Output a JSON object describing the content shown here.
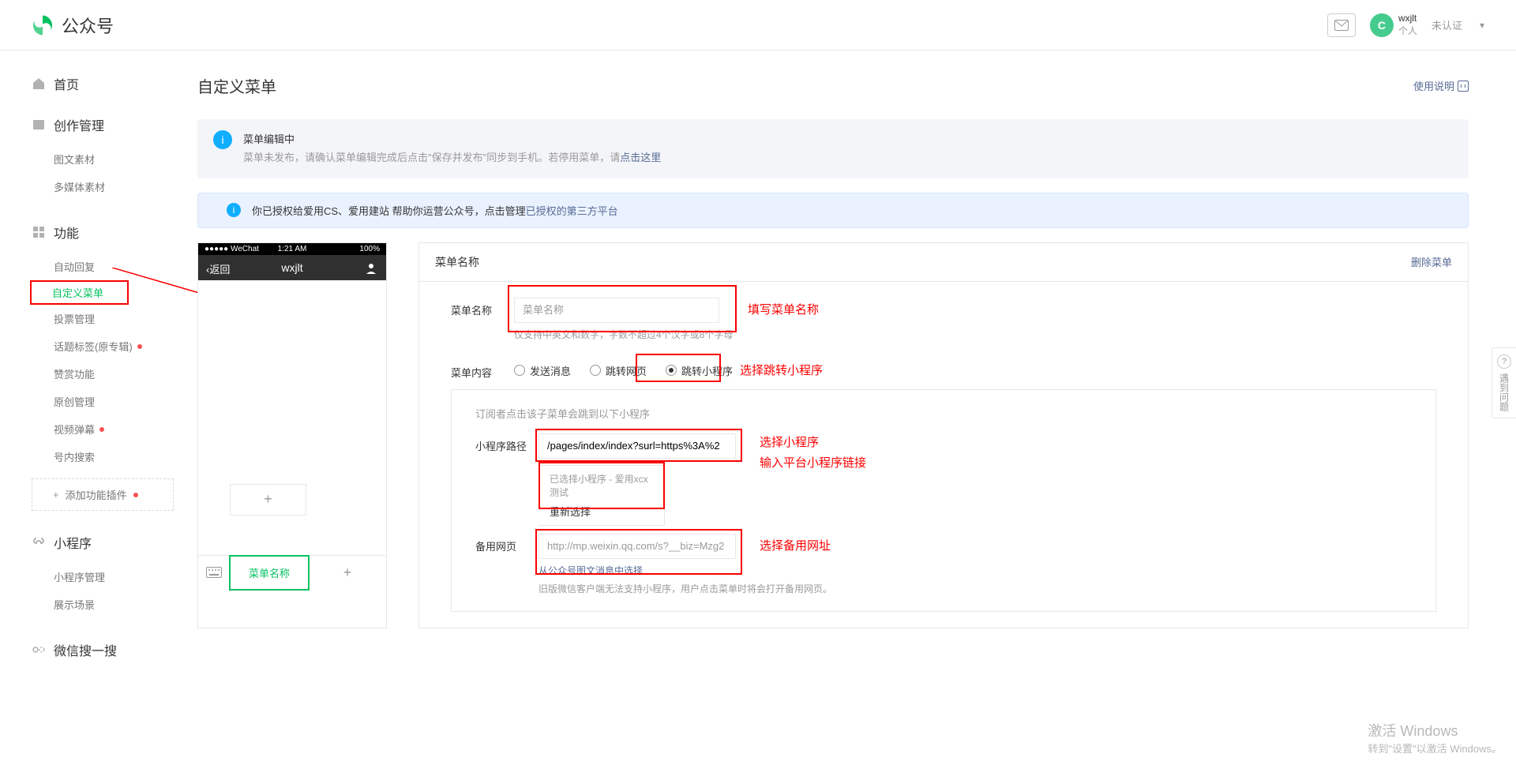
{
  "header": {
    "brand": "公众号",
    "user": {
      "name": "wxjlt",
      "role": "个人",
      "verify": "未认证"
    }
  },
  "sidebar": {
    "home": "首页",
    "sections": [
      {
        "title": "创作管理",
        "items": [
          {
            "label": "图文素材"
          },
          {
            "label": "多媒体素材"
          }
        ]
      },
      {
        "title": "功能",
        "items": [
          {
            "label": "自动回复"
          },
          {
            "label": "自定义菜单",
            "active": true
          },
          {
            "label": "投票管理"
          },
          {
            "label": "话题标签(原专辑)",
            "dot": true
          },
          {
            "label": "赞赏功能"
          },
          {
            "label": "原创管理"
          },
          {
            "label": "视频弹幕",
            "dot": true
          },
          {
            "label": "号内搜索"
          }
        ],
        "addPlugin": "添加功能插件",
        "addPluginDot": true
      },
      {
        "title": "小程序",
        "items": [
          {
            "label": "小程序管理"
          },
          {
            "label": "展示场景"
          }
        ]
      },
      {
        "title": "微信搜一搜",
        "items": []
      }
    ]
  },
  "page": {
    "title": "自定义菜单",
    "instructions": "使用说明"
  },
  "alert1": {
    "title": "菜单编辑中",
    "body_prefix": "菜单未发布，请确认菜单编辑完成后点击\"保存并发布\"同步到手机。若停用菜单，请",
    "body_link": "点击这里"
  },
  "alert2": {
    "body_prefix": "你已授权给爱用CS、爱用建站 帮助你运营公众号，点击管理",
    "body_link": "已授权的第三方平台"
  },
  "phone": {
    "carrier": "●●●●● WeChat",
    "time": "1:21 AM",
    "battery": "100%",
    "back": "返回",
    "title": "wxjlt",
    "menu_active": "菜单名称",
    "add": "+"
  },
  "form": {
    "head": "菜单名称",
    "delete": "删除菜单",
    "name_label": "菜单名称",
    "name_placeholder": "菜单名称",
    "name_help": "仅支持中英文和数字，字数不超过4个汉字或8个字母",
    "content_label": "菜单内容",
    "radios": [
      "发送消息",
      "跳转网页",
      "跳转小程序"
    ],
    "subpanel_desc": "订阅者点击该子菜单会跳到以下小程序",
    "path_label": "小程序路径",
    "path_value": "/pages/index/index?surl=https%3A%2",
    "selected_title": "已选择小程序 - 爱用xcx测试",
    "reselect": "重新选择",
    "backup_label": "备用网页",
    "backup_placeholder": "http://mp.weixin.qq.com/s?__biz=Mzg2",
    "backup_link": "从公众号图文消息中选择",
    "backup_help": "旧版微信客户端无法支持小程序，用户点击菜单时将会打开备用网页。"
  },
  "annotations": {
    "a1": "填写菜单名称",
    "a2": "选择跳转小程序",
    "a3": "选择小程序",
    "a4": "输入平台小程序链接",
    "a5": "选择备用网址"
  },
  "watermark": {
    "line1": "激活 Windows",
    "line2": "转到\"设置\"以激活 Windows。"
  },
  "feedback": "遇到问题"
}
